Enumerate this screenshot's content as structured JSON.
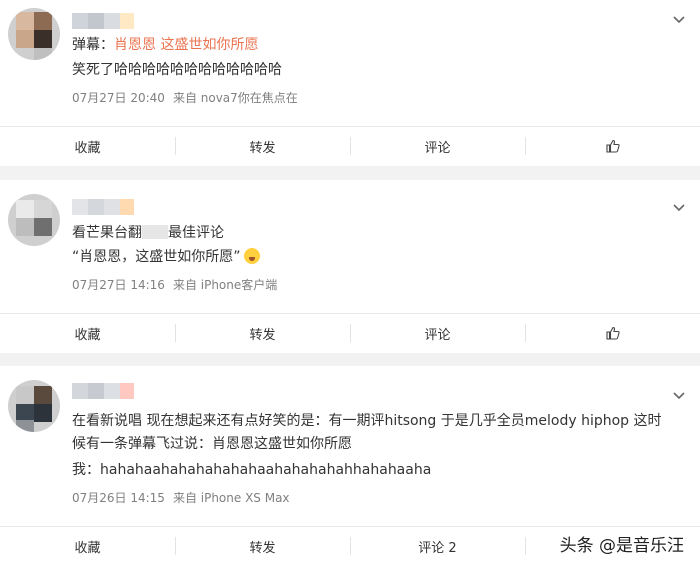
{
  "comments": [
    {
      "text_prefix": "弹幕：",
      "text_link": "肖恩恩 这盛世如你所愿",
      "text_line2": "笑死了哈哈哈哈哈哈哈哈哈哈哈哈",
      "date": "07月27日 20:40",
      "source": "来自 nova7你在焦点在",
      "actions": {
        "collect": "收藏",
        "forward": "转发",
        "comment": "评论"
      }
    },
    {
      "text_line1": "看芒果台翻",
      "text_line1_tail": "最佳评论",
      "text_line2": "“肖恩恩，这盛世如你所愿”",
      "date": "07月27日 14:16",
      "source": "来自 iPhone客户端",
      "actions": {
        "collect": "收藏",
        "forward": "转发",
        "comment": "评论"
      }
    },
    {
      "text_line1": "在看新说唱 现在想起来还有点好笑的是：有一期评hitsong 于是几乎全员melody hiphop 这时",
      "text_line2": "候有一条弹幕飞过说：肖恩恩这盛世如你所愿",
      "text_line3": "我：hahahaahahahahahahaahahahahahhahahaaha",
      "date": "07月26日 14:15",
      "source": "来自 iPhone XS Max",
      "actions": {
        "collect": "收藏",
        "forward": "转发",
        "comment": "评论 2"
      }
    }
  ],
  "icons": {
    "like": "thumbs-up-icon",
    "more": "chevron-down-icon",
    "emoji": "smiling-face-emoji"
  },
  "watermark": "头条 @是音乐汪",
  "colors": {
    "link": "#eb7350",
    "meta": "#808080",
    "bg": "#f2f2f2"
  }
}
